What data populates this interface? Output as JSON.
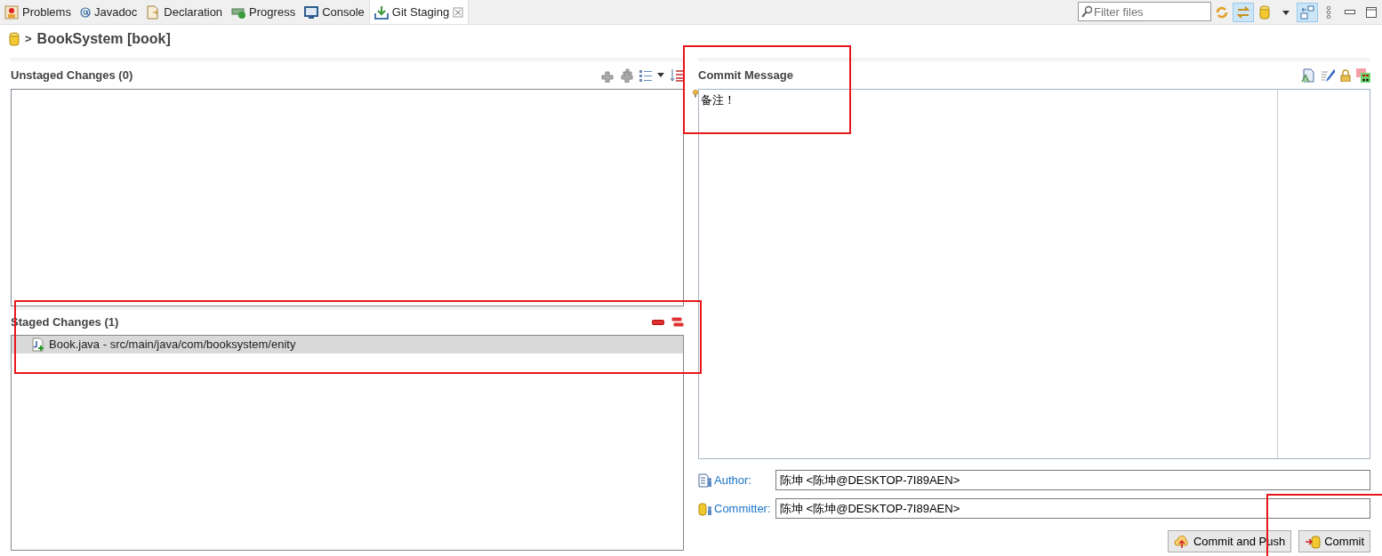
{
  "tabs": [
    {
      "label": "Problems",
      "kind": "problems",
      "selected": false
    },
    {
      "label": "Javadoc",
      "kind": "javadoc",
      "selected": false
    },
    {
      "label": "Declaration",
      "kind": "declaration",
      "selected": false
    },
    {
      "label": "Progress",
      "kind": "progress",
      "selected": false
    },
    {
      "label": "Console",
      "kind": "console",
      "selected": false
    },
    {
      "label": "Git Staging",
      "kind": "staging",
      "selected": true
    }
  ],
  "filter": {
    "placeholder": "Filter files"
  },
  "repository": {
    "separator": ">",
    "name": "BookSystem [book]"
  },
  "unstaged": {
    "title": "Unstaged Changes (0)"
  },
  "staged": {
    "title": "Staged Changes (1)",
    "files": [
      {
        "label": "Book.java - src/main/java/com/booksystem/enity",
        "selected": true
      }
    ]
  },
  "commit_message": {
    "title": "Commit Message",
    "value": "备注！"
  },
  "author": {
    "label": "Author:",
    "value": "陈坤 <陈坤@DESKTOP-7I89AEN>"
  },
  "committer": {
    "label": "Committer:",
    "value": "陈坤 <陈坤@DESKTOP-7I89AEN>"
  },
  "buttons": [
    {
      "label": "Commit and Push",
      "kind": "commit_push"
    },
    {
      "label": "Commit",
      "kind": "commit"
    }
  ],
  "annotations": [
    {
      "kind": "highlight"
    },
    {
      "kind": "highlight"
    },
    {
      "kind": "highlight"
    }
  ]
}
